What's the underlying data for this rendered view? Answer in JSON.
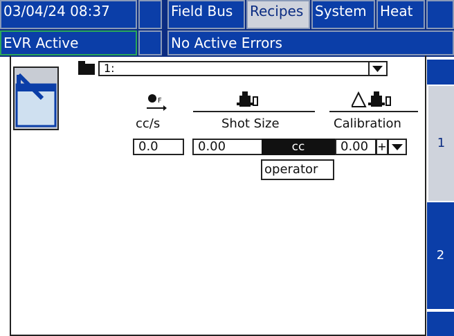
{
  "header": {
    "datetime": "03/04/24 08:37",
    "tabs": [
      {
        "label": "Field Bus",
        "selected": false
      },
      {
        "label": "Recipes",
        "selected": true
      },
      {
        "label": "System",
        "selected": false
      },
      {
        "label": "Heat",
        "selected": false
      }
    ],
    "status": "EVR Active",
    "errors": "No Active Errors"
  },
  "recipe": {
    "selector_value": "1:",
    "folder_icon": "folder-icon",
    "button_icon": "recipe-edit-icon"
  },
  "columns": {
    "flow": {
      "icon": "flow-rate-icon",
      "unit": "cc/s",
      "value": "0.0"
    },
    "shot": {
      "icon": "shot-pump-icon",
      "label": "Shot Size",
      "value": "0.00",
      "unit": "cc"
    },
    "calibration": {
      "icon": "delta-shot-icon",
      "label": "Calibration",
      "value": "0.00",
      "sign": "+"
    }
  },
  "popup": {
    "option": "operator"
  },
  "side_tabs": [
    {
      "label": "1",
      "selected": true
    },
    {
      "label": "2",
      "selected": false
    }
  ],
  "colors": {
    "header_blue": "#0b2c82",
    "tab_blue": "#0b3ea8",
    "selected_gray": "#cfd3dc",
    "status_green": "#2aa85a"
  }
}
